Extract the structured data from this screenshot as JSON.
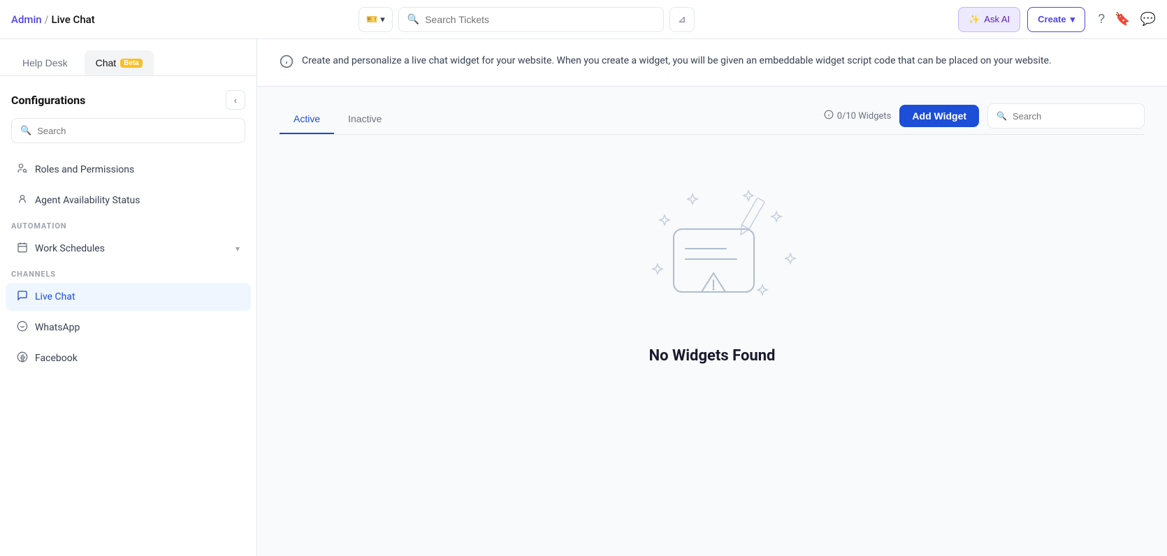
{
  "topNav": {
    "brand": "Admin",
    "slash": "/",
    "pageName": "Live Chat",
    "searchPlaceholder": "Search Tickets",
    "askAiLabel": "Ask AI",
    "createLabel": "Create"
  },
  "sidebar": {
    "tabs": [
      {
        "id": "helpdesk",
        "label": "Help Desk",
        "active": false
      },
      {
        "id": "chat",
        "label": "Chat",
        "badge": "Beta",
        "active": true
      }
    ],
    "title": "Configurations",
    "searchPlaceholder": "Search",
    "sections": [
      {
        "id": "main-items",
        "items": [
          {
            "id": "roles",
            "icon": "👥",
            "label": "Roles and Permissions"
          },
          {
            "id": "agent-status",
            "icon": "👤",
            "label": "Agent Availability Status"
          }
        ]
      },
      {
        "id": "automation",
        "label": "AUTOMATION",
        "items": [
          {
            "id": "work-schedules",
            "icon": "📅",
            "label": "Work Schedules",
            "hasChevron": true
          }
        ]
      },
      {
        "id": "channels",
        "label": "CHANNELS",
        "items": [
          {
            "id": "live-chat",
            "icon": "💬",
            "label": "Live Chat",
            "active": true
          },
          {
            "id": "whatsapp",
            "icon": "📱",
            "label": "WhatsApp"
          },
          {
            "id": "facebook",
            "icon": "🌐",
            "label": "Facebook"
          }
        ]
      }
    ]
  },
  "infoBanner": {
    "text": "Create and personalize a live chat widget for your website. When you create a widget, you will be given an embeddable widget script code that can be placed on your website."
  },
  "tabs": [
    {
      "id": "active",
      "label": "Active",
      "active": true
    },
    {
      "id": "inactive",
      "label": "Inactive",
      "active": false
    }
  ],
  "widgetCount": "0/10 Widgets",
  "addWidgetLabel": "Add Widget",
  "searchWidgetPlaceholder": "Search",
  "emptyState": {
    "title": "No Widgets Found"
  }
}
